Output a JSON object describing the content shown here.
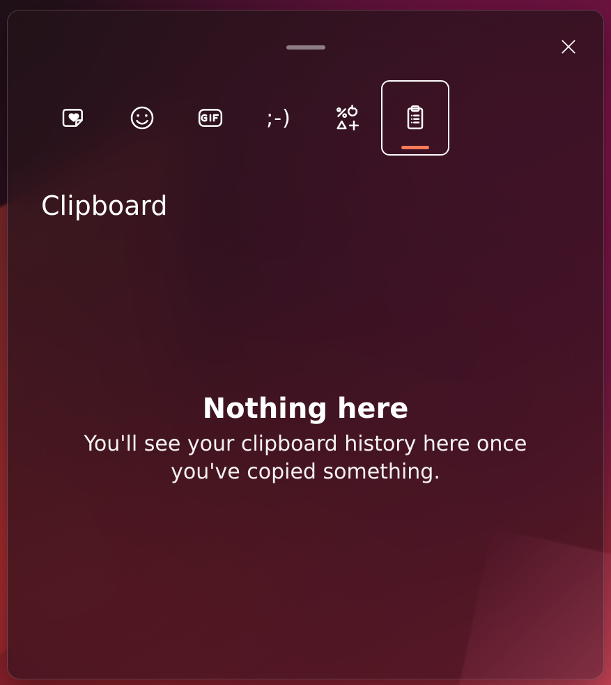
{
  "tabs": {
    "recent": {
      "name": "recent",
      "selected": false
    },
    "emoji": {
      "name": "emoji",
      "selected": false
    },
    "gif": {
      "name": "gif",
      "selected": false
    },
    "kaomoji": {
      "name": "kaomoji",
      "label": ";-)",
      "selected": false
    },
    "symbols": {
      "name": "symbols",
      "selected": false
    },
    "clipboard": {
      "name": "clipboard",
      "selected": true
    }
  },
  "section_title": "Clipboard",
  "empty": {
    "headline": "Nothing here",
    "body": "You'll see your clipboard history here once you've copied something."
  },
  "close_label": "Close"
}
